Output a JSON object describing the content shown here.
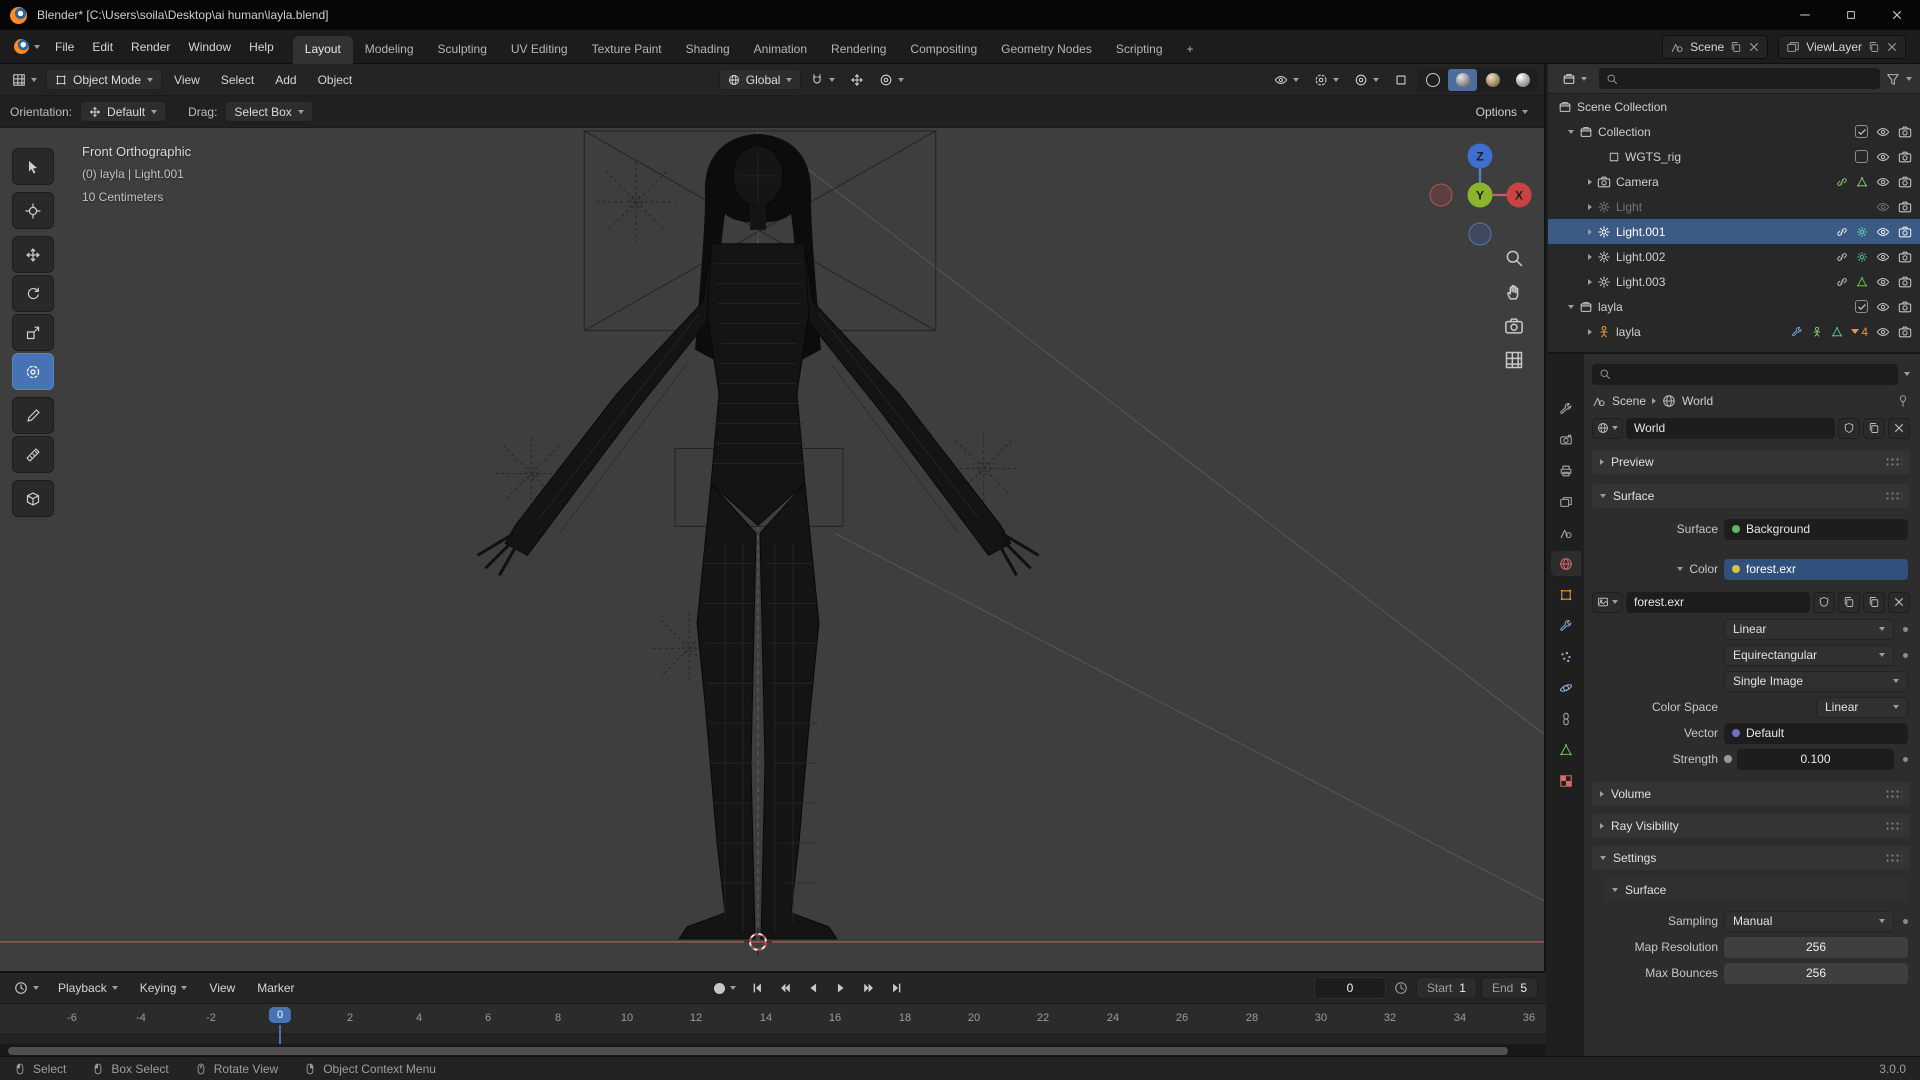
{
  "colors": {
    "accent": "#4772b3",
    "selection": "#3b5b85",
    "object_orange": "#e8973c",
    "axis_x": "#c84444",
    "axis_y": "#8bb32c",
    "axis_z": "#3f6fd0"
  },
  "titlebar": {
    "title": "Blender* [C:\\Users\\soila\\Desktop\\ai human\\layla.blend]"
  },
  "topbar": {
    "menus": [
      "File",
      "Edit",
      "Render",
      "Window",
      "Help"
    ],
    "workspaces": [
      "Layout",
      "Modeling",
      "Sculpting",
      "UV Editing",
      "Texture Paint",
      "Shading",
      "Animation",
      "Rendering",
      "Compositing",
      "Geometry Nodes",
      "Scripting"
    ],
    "add_tab": "+",
    "scene_label": "Scene",
    "viewlayer_label": "ViewLayer"
  },
  "viewport": {
    "mode": "Object Mode",
    "menus": [
      "View",
      "Select",
      "Add",
      "Object"
    ],
    "orientation": "Global",
    "tool_settings": {
      "orientation_label": "Orientation:",
      "orientation_value": "Default",
      "drag_label": "Drag:",
      "drag_value": "Select Box",
      "options_label": "Options"
    },
    "overlay": {
      "view_name": "Front Orthographic",
      "active_object": "(0) layla | Light.001",
      "grid_scale": "10 Centimeters"
    },
    "gizmo": {
      "x": "X",
      "y": "Y",
      "z": "Z"
    }
  },
  "outliner": {
    "rows": [
      {
        "label": "Scene Collection"
      },
      {
        "label": "Collection"
      },
      {
        "label": "WGTS_rig"
      },
      {
        "label": "Camera"
      },
      {
        "label": "Light"
      },
      {
        "label": "Light.001"
      },
      {
        "label": "Light.002"
      },
      {
        "label": "Light.003"
      },
      {
        "label": "layla"
      },
      {
        "label": "layla",
        "badge": "4"
      }
    ]
  },
  "properties": {
    "breadcrumb": {
      "scene": "Scene",
      "world": "World"
    },
    "world_name": "World",
    "panels": {
      "preview": "Preview",
      "surface": "Surface",
      "volume": "Volume",
      "ray_visibility": "Ray Visibility",
      "settings": "Settings",
      "settings_surface": "Surface"
    },
    "surface": {
      "surface_label": "Surface",
      "surface_value": "Background",
      "color_label": "Color",
      "color_value": "forest.exr",
      "image_name": "forest.exr",
      "interpolation": "Linear",
      "projection": "Equirectangular",
      "source": "Single Image",
      "colorspace_label": "Color Space",
      "colorspace_value": "Linear",
      "vector_label": "Vector",
      "vector_value": "Default",
      "strength_label": "Strength",
      "strength_value": "0.100"
    },
    "settings": {
      "sampling_label": "Sampling",
      "sampling_value": "Manual",
      "map_resolution_label": "Map Resolution",
      "map_resolution_value": "256",
      "max_bounces_label": "Max Bounces",
      "max_bounces_value": "256"
    }
  },
  "timeline": {
    "menus": [
      "Playback",
      "Keying",
      "View",
      "Marker"
    ],
    "ticks": [
      "-6",
      "-4",
      "-2",
      "0",
      "2",
      "4",
      "6",
      "8",
      "10",
      "12",
      "14",
      "16",
      "18",
      "20",
      "22",
      "24",
      "26",
      "28",
      "30",
      "32",
      "34",
      "36"
    ],
    "current_frame": "0",
    "frame_field": "0",
    "start_label": "Start",
    "start_value": "1",
    "end_label": "End",
    "end_value": "5"
  },
  "statusbar": {
    "hints": [
      "Select",
      "Box Select",
      "Rotate View",
      "Object Context Menu"
    ],
    "version": "3.0.0"
  }
}
